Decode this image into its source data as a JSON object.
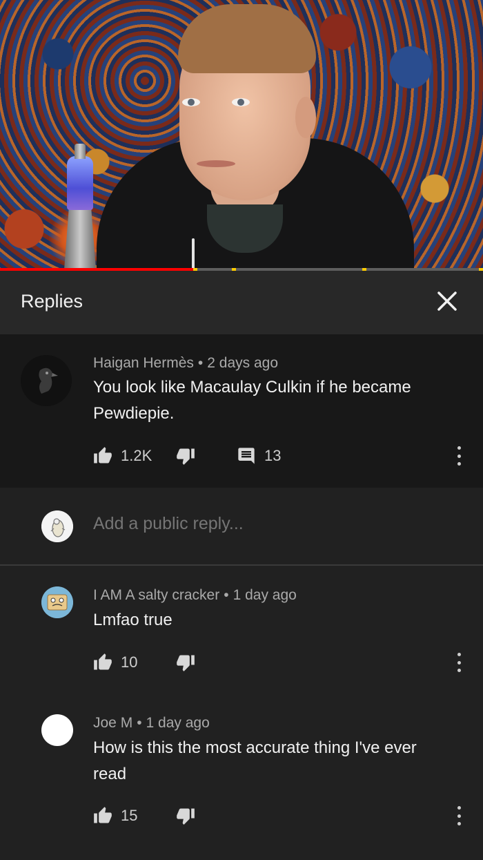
{
  "video": {
    "progress_fraction": 0.4,
    "marker_positions": [
      0.4,
      0.48,
      0.75,
      0.994
    ]
  },
  "header": {
    "title": "Replies"
  },
  "icons": {
    "close": "close-icon",
    "like": "thumbs-up-icon",
    "dislike": "thumbs-down-icon",
    "reply": "comment-icon",
    "more": "more-vertical-icon"
  },
  "colors": {
    "progress": "#ff0000",
    "marker": "#ffcc00",
    "background": "#212121",
    "thread_background": "#181818"
  },
  "parent_comment": {
    "author": "Haigan Hermès",
    "time": "2 days ago",
    "text": "You look like Macaulay Culkin if he became Pewdiepie.",
    "likes": "1.2K",
    "replies": "13"
  },
  "reply_box": {
    "placeholder": "Add a public reply..."
  },
  "replies": [
    {
      "author": "I AM A salty cracker",
      "time": "1 day ago",
      "text": "Lmfao true",
      "likes": "10"
    },
    {
      "author": "Joe M",
      "time": "1 day ago",
      "text": "How is this the most accurate thing I've ever read",
      "likes": "15"
    }
  ]
}
